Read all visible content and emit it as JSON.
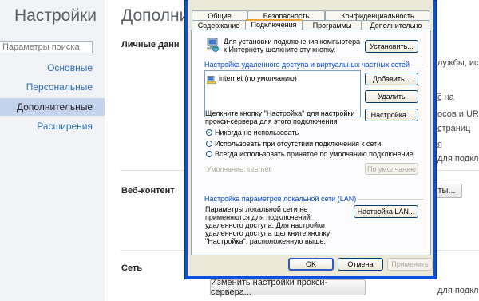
{
  "settings_page": {
    "sidebar_title": "Настройки",
    "search_placeholder": "Параметры поиска",
    "nav": [
      {
        "label": "Основные"
      },
      {
        "label": "Персональные"
      },
      {
        "label": "Дополнительные",
        "active": true
      },
      {
        "label": "Расширения"
      }
    ],
    "page_title": "Дополни",
    "sections": {
      "personal": "Личные данн",
      "web_content": "Веб-контент",
      "network": "Сеть"
    },
    "right_fragments": [
      "лужбы, исп",
      "с на",
      "осов и URL",
      "страниц",
      "я",
      "для подкл",
      "для подкл"
    ],
    "webcontent_button_fragment": "ты...",
    "proxy_button": "Изменить настройки прокси-сервера..."
  },
  "dialog": {
    "tabs_row1": [
      "Общие",
      "Безопасность",
      "Конфиденциальность"
    ],
    "tabs_row2": [
      "Содержание",
      "Подключения",
      "Программы",
      "Дополнительно"
    ],
    "active_tab": "Подключения",
    "setup_text": "Для установки подключения компьютера к Интернету щелкните эту кнопку.",
    "setup_button": "Установить...",
    "dialup_group_title": "Настройка удаленного доступа и виртуальных частных сетей",
    "connections": [
      "internet (по умолчанию)"
    ],
    "add_button": "Добавить...",
    "remove_button": "Удалить",
    "proxy_hint": "Щелкните кнопку \"Настройка\" для настройки прокси-сервера для этого подключения.",
    "settings_button": "Настройка...",
    "radio_options": [
      {
        "label": "Никогда не использовать",
        "checked": true
      },
      {
        "label": "Использовать при отсутствии подключения к сети",
        "checked": false
      },
      {
        "label": "Всегда использовать принятое по умолчанию подключение",
        "checked": false
      }
    ],
    "default_label": "Умолчание:",
    "default_value": "internet",
    "default_button": "По умолчанию",
    "lan_group_title": "Настройка параметров локальной сети (LAN)",
    "lan_text": "Параметры локальной сети не применяются для подключений удаленного доступа. Для настройки удаленного доступа щелкните кнопку \"Настройка\", расположенную выше.",
    "lan_button": "Настройка LAN...",
    "ok_button": "OK",
    "cancel_button": "Отмена",
    "apply_button": "Применить"
  }
}
